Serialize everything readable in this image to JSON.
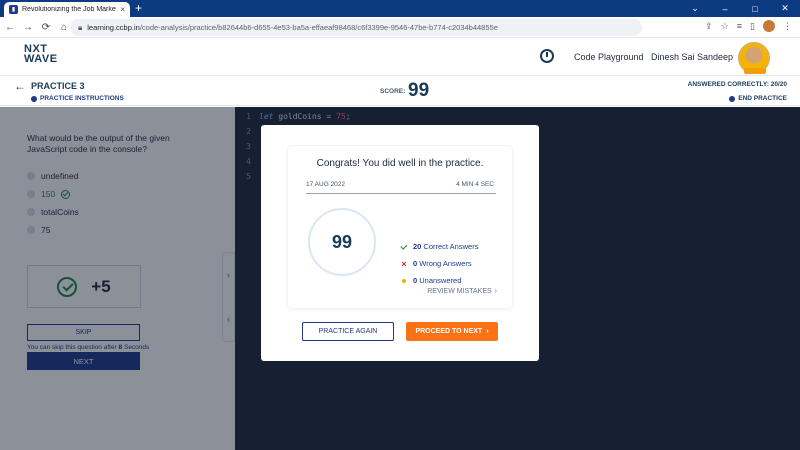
{
  "browser": {
    "tab_title": "Revolutionizing the Job Market | ",
    "tab_close": "×",
    "new_tab": "+",
    "url_host": "learning.ccbp.in",
    "url_path": "/code-analysis/practice/b82644b6-d655-4e53-ba5a-effaeaf98468/c6f3399e-9546-47be-b774-c2034b44855e",
    "window_controls": [
      "⌄",
      "–",
      "□",
      "✕"
    ]
  },
  "header": {
    "logo_line1": "NXT",
    "logo_line2": "WAVE",
    "code_playground": "Code Playground",
    "user_name": "Dinesh Sai Sandeep"
  },
  "practice_bar": {
    "title": "PRACTICE 3",
    "instructions": "PRACTICE INSTRUCTIONS",
    "score_label": "SCORE:",
    "score_value": "99",
    "answered": "ANSWERED CORRECTLY: 20/20",
    "end_practice": "END PRACTICE"
  },
  "question": {
    "text": "What would be the output of the given JavaScript code in the console?",
    "options": [
      "undefined",
      "150",
      "totalCoins",
      "75"
    ],
    "points": "+5",
    "skip_label": "SKIP",
    "skip_note_prefix": "You can skip this question after ",
    "skip_note_seconds": "8",
    "skip_note_suffix": " Seconds",
    "next_label": "NEXT"
  },
  "editor": {
    "line_numbers": [
      "1",
      "2",
      "3",
      "4",
      "5"
    ],
    "line1_keyword": "let",
    "line1_name": " goldCoins = ",
    "line1_value": "75",
    "line1_end": ";"
  },
  "modal": {
    "congrats": "Congrats! You did well in the practice.",
    "date": "17 AUG 2022",
    "duration": "4 MIN 4 SEC",
    "score": "99",
    "correct_count": "20",
    "correct_label": " Correct Answers",
    "wrong_count": "0",
    "wrong_label": " Wrong Answers",
    "unanswered_count": "0",
    "unanswered_label": " Unanswered",
    "review_label": "REVIEW MISTAKES",
    "practice_again": "PRACTICE AGAIN",
    "proceed": "PROCEED TO NEXT"
  }
}
